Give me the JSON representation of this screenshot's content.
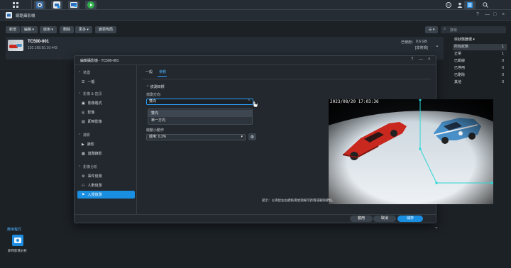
{
  "taskbar": {
    "icons": [
      "apps-grid-icon",
      "surveillance-icon",
      "camera-icon",
      "desktop-icon",
      "play-icon"
    ],
    "right_icons": [
      "chat-icon",
      "user-icon",
      "widgets-icon",
      "search-icon"
    ]
  },
  "window": {
    "title": "網路攝影機",
    "controls": [
      "?",
      "—",
      "□",
      "×"
    ]
  },
  "toolbar": {
    "add": "新增",
    "edit": "編輯 ▾",
    "enable": "啟用 ▾",
    "delete": "刪除",
    "more": "更多 ▾",
    "view_layout": "變更佈局",
    "search_placeholder": "搜尋"
  },
  "camera": {
    "name": "TC500-001",
    "ip": "192.168.50.16:443",
    "used_label": "已使用：",
    "used_value": "0.6 GB",
    "status": "[非常規]"
  },
  "right_panel": {
    "header": "依狀態篩選 ▾",
    "rows": [
      {
        "label": "所有狀態",
        "count": "1"
      },
      {
        "label": "正常",
        "count": "1"
      },
      {
        "label": "已斷線",
        "count": "0"
      },
      {
        "label": "已停用",
        "count": "0"
      },
      {
        "label": "已刪除",
        "count": "0"
      },
      {
        "label": "其他",
        "count": "0"
      }
    ]
  },
  "bottom": {
    "section_title": "應用程式",
    "app_label": "即時影像分析"
  },
  "dialog": {
    "title": "編輯攝影機 - TC500-001",
    "controls": [
      "?",
      "—",
      "×"
    ],
    "sidebar": {
      "device_head": "裝置",
      "general": "一般",
      "video_head": "影像 & 音訊",
      "video_format": "影像格式",
      "image": "影像",
      "live": "即時影像",
      "record_head": "錄影",
      "recording": "錄影",
      "advanced_record": "進階錄影",
      "analytics_head": "影像分析",
      "event_detection": "事件偵測",
      "people_count": "人數偵測",
      "intrusion": "入侵偵測"
    },
    "tabs": {
      "general": "一般",
      "params": "參數"
    },
    "section": "偵測目標",
    "direction_label": "偵測方向",
    "direction_value": "雙向",
    "dropdown_options": [
      "雙向",
      "單一方向"
    ],
    "action_label": "啟動小動作",
    "action_value": "啟用: 0.2%",
    "timestamp": "2023/08/20 17:03:36",
    "hint": "提示：以滑鼠左右鍵拖曳偵測線可新增或刪除節點。",
    "buttons": {
      "apply": "套用",
      "cancel": "取消",
      "save": "儲存"
    }
  },
  "colors": {
    "accent": "#1a8ee0",
    "detect_line": "#2ad6d6",
    "car_red": "#c8281e",
    "car_blue": "#4a90c8"
  }
}
